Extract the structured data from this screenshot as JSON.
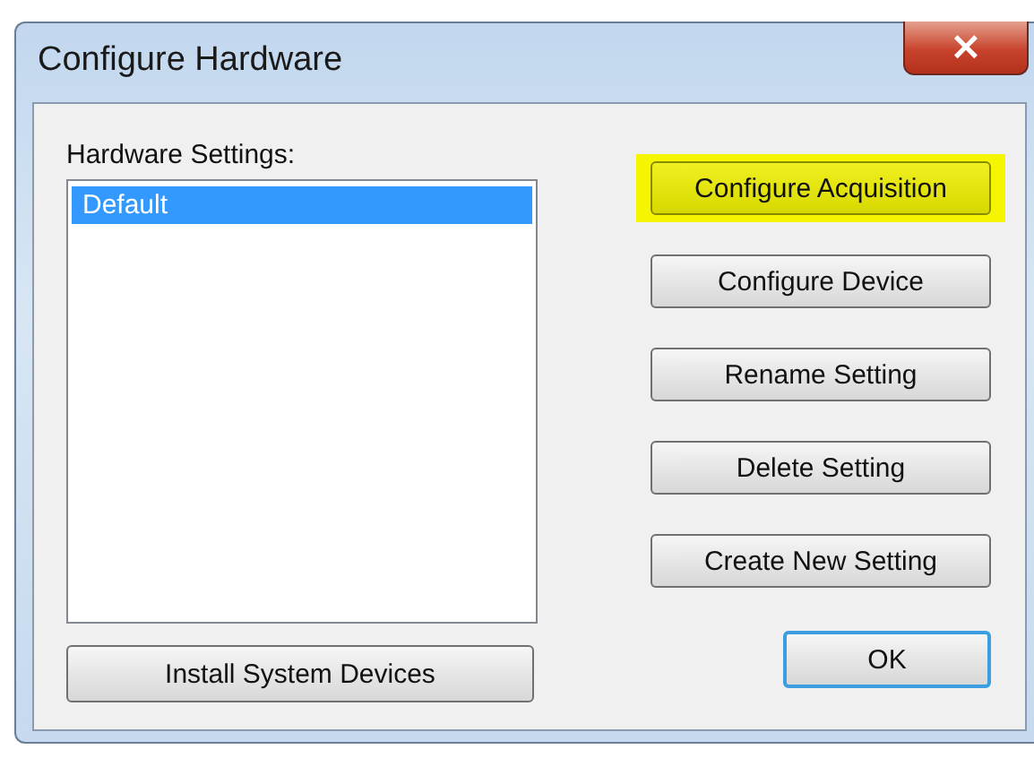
{
  "window": {
    "title": "Configure Hardware",
    "close": "×"
  },
  "settings": {
    "label": "Hardware Settings:",
    "items": [
      {
        "label": "Default",
        "selected": true
      }
    ]
  },
  "buttons": [
    {
      "label": "Configure Acquisition",
      "highlighted": true
    },
    {
      "label": "Configure Device",
      "highlighted": false
    },
    {
      "label": "Rename Setting",
      "highlighted": false
    },
    {
      "label": "Delete Setting",
      "highlighted": false
    },
    {
      "label": "Create New Setting",
      "highlighted": false
    }
  ],
  "install_button": "Install System Devices",
  "ok_button": {
    "label": "OK",
    "default": true
  }
}
